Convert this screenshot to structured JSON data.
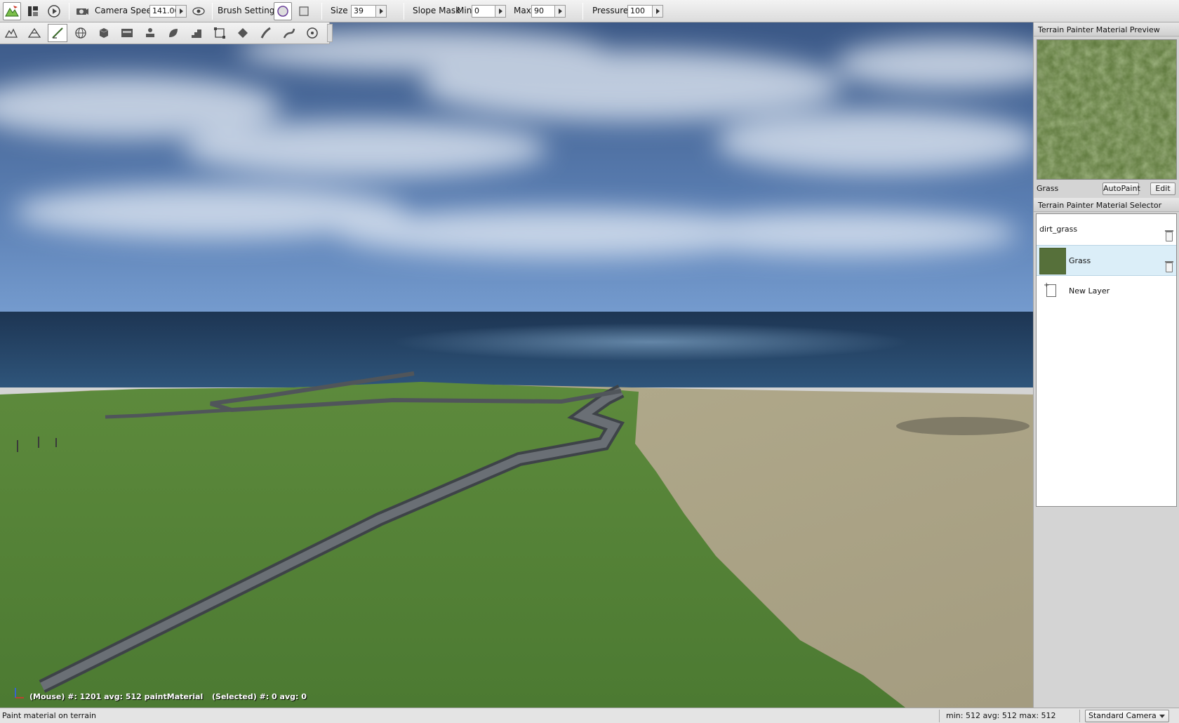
{
  "toolbar": {
    "camera_speed_label": "Camera Speed",
    "camera_speed_value": "141.00",
    "brush_settings_label": "Brush Settings",
    "size_label": "Size",
    "size_value": "39",
    "slope_mask_label": "Slope Mask",
    "min_label": "Min",
    "min_value": "0",
    "max_label": "Max",
    "max_value": "90",
    "pressure_label": "Pressure",
    "pressure_value": "100"
  },
  "tools": [
    "terrain-editor-icon",
    "mesh-icon",
    "paint-brush-icon",
    "globe-icon",
    "cube-icon",
    "data-icon",
    "stamp-icon",
    "leaf-icon",
    "stairs-icon",
    "transform-icon",
    "decal-icon",
    "road-icon",
    "river-icon",
    "wheel-icon"
  ],
  "viewport": {
    "mouse_info": "(Mouse) #: 1201  avg: 512 paintMaterial",
    "selected_info": "(Selected) #: 0  avg: 0"
  },
  "preview": {
    "title": "Terrain Painter Material Preview",
    "material_name": "Grass",
    "autopaint_label": "AutoPaint",
    "edit_label": "Edit"
  },
  "selector": {
    "title": "Terrain Painter Material Selector",
    "layers": [
      {
        "name": "dirt_grass",
        "selected": false
      },
      {
        "name": "Grass",
        "selected": true
      }
    ],
    "new_layer_label": "New Layer"
  },
  "status": {
    "message": "Paint material on terrain",
    "stats": "min: 512  avg: 512  max: 512",
    "camera": "Standard Camera"
  },
  "colors": {
    "sky_top": "#3a5a8c",
    "sea": "#1f3c5c",
    "grass": "#55823a",
    "sand": "#b9b092",
    "selected_row": "#dbeef8"
  }
}
